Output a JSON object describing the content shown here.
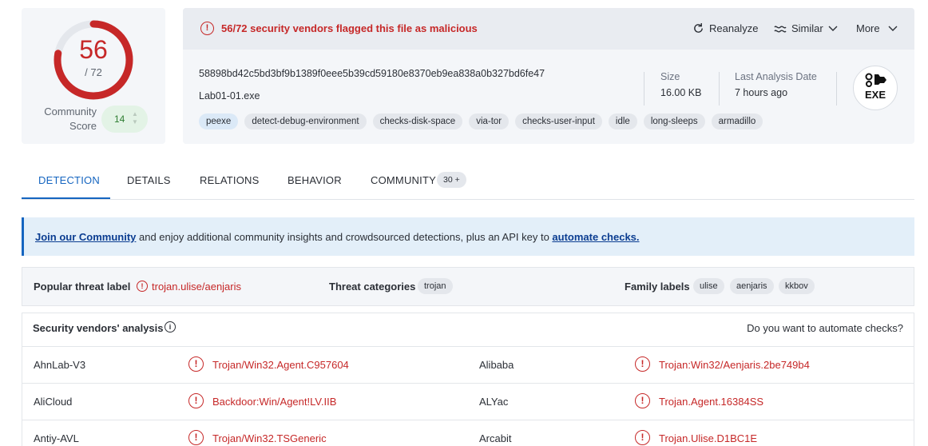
{
  "score": {
    "malicious": "56",
    "total": "/ 72",
    "fraction": 0.778,
    "community_label": "Community Score",
    "community_value": "14",
    "accent_color": "#c62828"
  },
  "alert": {
    "icon": "alert-circle-icon",
    "text": "56/72 security vendors flagged this file as malicious"
  },
  "actions": {
    "reanalyze": "Reanalyze",
    "similar": "Similar",
    "more": "More"
  },
  "file": {
    "hash": "58898bd42c5bd3bf9b1389f0eee5b39cd59180e8370eb9ea838a0b327bd6fe47",
    "name": "Lab01-01.exe",
    "tags": [
      "peexe",
      "detect-debug-environment",
      "checks-disk-space",
      "via-tor",
      "checks-user-input",
      "idle",
      "long-sleeps",
      "armadillo"
    ],
    "size_label": "Size",
    "size_value": "16.00 KB",
    "date_label": "Last Analysis Date",
    "date_value": "7 hours ago",
    "type_badge": "EXE"
  },
  "tabs": {
    "detection": "DETECTION",
    "details": "DETAILS",
    "relations": "RELATIONS",
    "behavior": "BEHAVIOR",
    "community": "COMMUNITY",
    "community_count": "30 +"
  },
  "banner": {
    "link1": "Join our Community",
    "middle": " and enjoy additional community insights and crowdsourced detections, plus an API key to ",
    "link2": "automate checks."
  },
  "threat": {
    "popular_label": "Popular threat label",
    "popular_value": "trojan.ulise/aenjaris",
    "categories_label": "Threat categories",
    "categories": [
      "trojan"
    ],
    "family_label": "Family labels",
    "families": [
      "ulise",
      "aenjaris",
      "kkbov"
    ]
  },
  "vendors": {
    "title": "Security vendors' analysis",
    "question": "Do you want to automate checks?",
    "rows": [
      {
        "left_name": "AhnLab-V3",
        "left_result": "Trojan/Win32.Agent.C957604",
        "right_name": "Alibaba",
        "right_result": "Trojan:Win32/Aenjaris.2be749b4"
      },
      {
        "left_name": "AliCloud",
        "left_result": "Backdoor:Win/Agent!LV.IIB",
        "right_name": "ALYac",
        "right_result": "Trojan.Agent.16384SS"
      },
      {
        "left_name": "Antiy-AVL",
        "left_result": "Trojan/Win32.TSGeneric",
        "right_name": "Arcabit",
        "right_result": "Trojan.Ulise.D1BC1E"
      }
    ]
  }
}
